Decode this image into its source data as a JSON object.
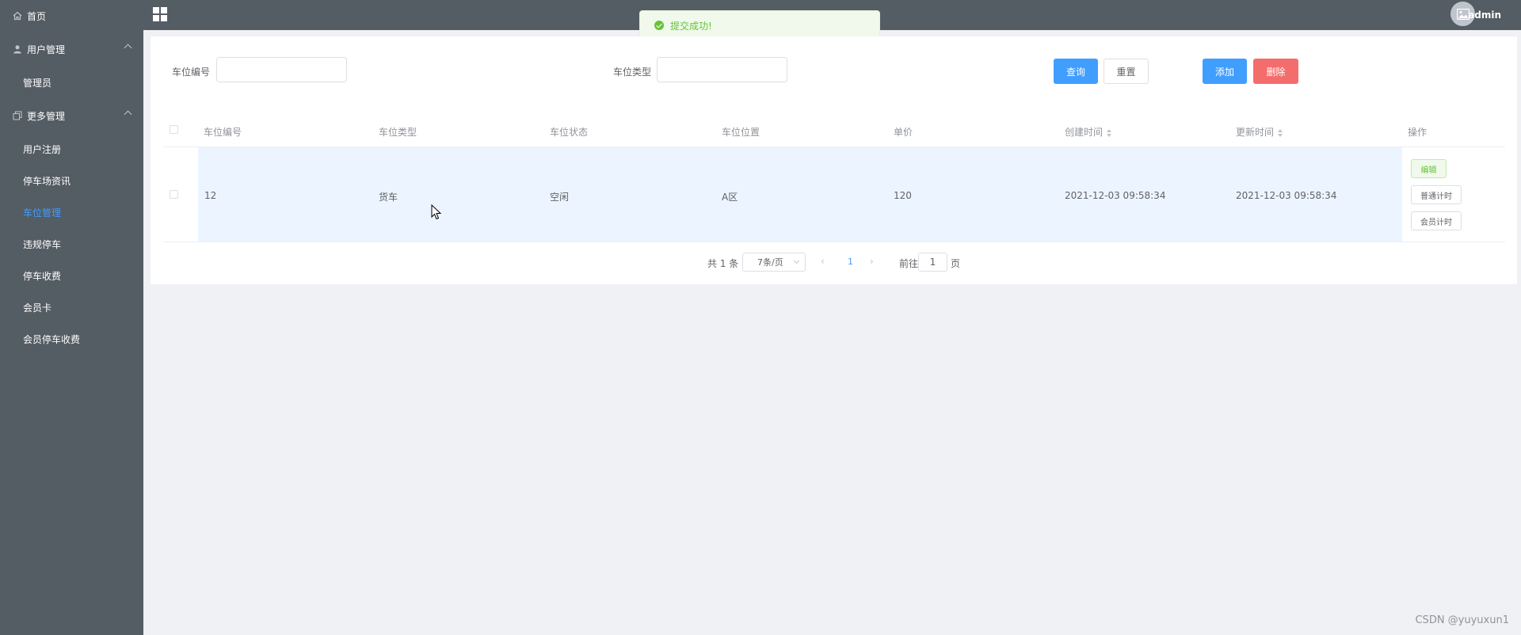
{
  "sidebar": {
    "home": "首页",
    "groups": [
      {
        "label": "用户管理",
        "items": [
          "管理员"
        ]
      },
      {
        "label": "更多管理",
        "items": [
          "用户注册",
          "停车场资讯",
          "车位管理",
          "违规停车",
          "停车收费",
          "会员卡",
          "会员停车收费"
        ]
      }
    ],
    "active_item": "车位管理"
  },
  "header": {
    "username": "admin"
  },
  "toast": {
    "message": "提交成功!"
  },
  "search": {
    "field1_label": "车位编号",
    "field1_value": "",
    "field2_label": "车位类型",
    "field2_value": "",
    "query_label": "查询",
    "reset_label": "重置",
    "add_label": "添加",
    "delete_label": "删除"
  },
  "table": {
    "columns": [
      "车位编号",
      "车位类型",
      "车位状态",
      "车位位置",
      "单价",
      "创建时间",
      "更新时间",
      "操作"
    ],
    "rows": [
      {
        "number": "12",
        "type": "货车",
        "status": "空闲",
        "location": "A区",
        "price": "120",
        "created": "2021-12-03 09:58:34",
        "updated": "2021-12-03 09:58:34",
        "actions": [
          "编辑",
          "普通计时",
          "会员计时"
        ]
      }
    ]
  },
  "pagination": {
    "total_text": "共 1 条",
    "page_size": "7条/页",
    "current_page": "1",
    "goto_label": "前往",
    "goto_value": "1",
    "page_suffix": "页"
  },
  "watermark": "CSDN @yuyuxun1",
  "colors": {
    "sidebar_bg": "#545c64",
    "primary": "#409eff",
    "danger": "#f56c6c",
    "success": "#67c23a"
  }
}
